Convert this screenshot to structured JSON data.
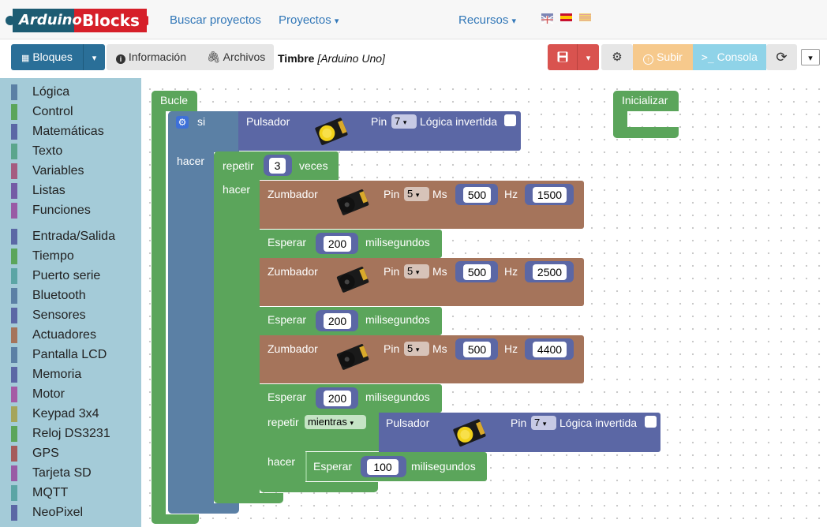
{
  "logo": {
    "part1": "Arduino",
    "part2": "Blocks"
  },
  "nav": {
    "search": "Buscar proyectos",
    "projects": "Proyectos",
    "resources": "Recursos",
    "caret": "▾"
  },
  "flags": [
    "english-flag",
    "spanish-flag",
    "catalan-flag"
  ],
  "toolbar": {
    "blocks": "Bloques",
    "info": "Información",
    "files": "Archivos",
    "project_name": "Timbre",
    "board": "[Arduino Uno]",
    "upload": "Subir",
    "console": "Consola",
    "caret": "▾"
  },
  "categories": [
    {
      "label": "Lógica",
      "color": "#5b80a5"
    },
    {
      "label": "Control",
      "color": "#5ba55b"
    },
    {
      "label": "Matemáticas",
      "color": "#5b67a5"
    },
    {
      "label": "Texto",
      "color": "#5ba58c"
    },
    {
      "label": "Variables",
      "color": "#a55b80"
    },
    {
      "label": "Listas",
      "color": "#745ba5"
    },
    {
      "label": "Funciones",
      "color": "#995ba5"
    },
    {
      "label": "Entrada/Salida",
      "color": "#5b67a5"
    },
    {
      "label": "Tiempo",
      "color": "#5ba55b"
    },
    {
      "label": "Puerto serie",
      "color": "#5ba5a5"
    },
    {
      "label": "Bluetooth",
      "color": "#5b80a5"
    },
    {
      "label": "Sensores",
      "color": "#5b67a5"
    },
    {
      "label": "Actuadores",
      "color": "#a5745b"
    },
    {
      "label": "Pantalla LCD",
      "color": "#5b80a5"
    },
    {
      "label": "Memoria",
      "color": "#5b67a5"
    },
    {
      "label": "Motor",
      "color": "#a55ba5"
    },
    {
      "label": "Keypad 3x4",
      "color": "#a5a55b"
    },
    {
      "label": "Reloj DS3231",
      "color": "#5ba55b"
    },
    {
      "label": "GPS",
      "color": "#a55b5b"
    },
    {
      "label": "Tarjeta SD",
      "color": "#995ba5"
    },
    {
      "label": "MQTT",
      "color": "#5ba5a5"
    },
    {
      "label": "NeoPixel",
      "color": "#5b67a5"
    }
  ],
  "blocks": {
    "loop": "Bucle",
    "setup": "Inicializar",
    "if": "si",
    "do": "hacer",
    "button": "Pulsador",
    "pin": "Pin",
    "inverted": "Lógica invertida",
    "button_pin": "7",
    "repeat": "repetir",
    "times": "veces",
    "repeat_count": "3",
    "buzzer": "Zumbador",
    "ms": "Ms",
    "hz": "Hz",
    "wait": "Esperar",
    "milliseconds": "milisegundos",
    "buzzers": [
      {
        "pin": "5",
        "ms": "500",
        "hz": "1500"
      },
      {
        "pin": "5",
        "ms": "500",
        "hz": "2500"
      },
      {
        "pin": "5",
        "ms": "500",
        "hz": "4400"
      }
    ],
    "waits": [
      "200",
      "200",
      "200"
    ],
    "while_mode": "mientras",
    "inner_wait": "100"
  },
  "colors": {
    "logic": "#5b80a5",
    "control": "#5ba55b",
    "io": "#5b67a5",
    "actuator": "#a5745b",
    "nav_link": "#3378b8",
    "primary": "#337ab7",
    "danger": "#d9534f",
    "warning": "#f6c98c",
    "info": "#8fd3e8"
  }
}
